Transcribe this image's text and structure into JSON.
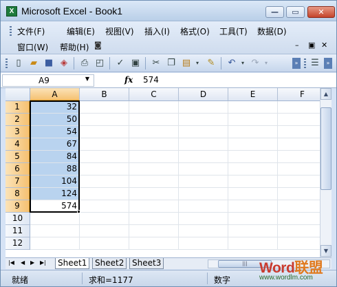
{
  "window": {
    "title": "Microsoft Excel - Book1",
    "app_icon": "excel-x-icon",
    "buttons": {
      "minimize": "—",
      "restore": "▭",
      "close": "✕"
    }
  },
  "menu": {
    "row1": [
      "文件(F)",
      "编辑(E)",
      "视图(V)",
      "插入(I)",
      "格式(O)",
      "工具(T)",
      "数据(D)"
    ],
    "row2": [
      "窗口(W)",
      "帮助(H)"
    ],
    "doc_controls": {
      "minimize": "–",
      "restore": "▣",
      "close": "✕"
    }
  },
  "toolbar": {
    "icons": [
      "new-icon",
      "open-icon",
      "save-icon",
      "permission-icon",
      "print-icon",
      "print-preview-icon",
      "spelling-icon",
      "research-icon",
      "cut-icon",
      "copy-icon",
      "paste-icon",
      "format-painter-icon",
      "undo-icon",
      "redo-icon",
      "align-icon"
    ]
  },
  "formula_bar": {
    "name_box": "A9",
    "fx": "fx",
    "value": "574"
  },
  "sheet": {
    "columns": [
      "A",
      "B",
      "C",
      "D",
      "E",
      "F"
    ],
    "rows": [
      "1",
      "2",
      "3",
      "4",
      "5",
      "6",
      "7",
      "8",
      "9",
      "10",
      "11",
      "12"
    ],
    "col_a_values": [
      "32",
      "50",
      "54",
      "67",
      "84",
      "88",
      "104",
      "124",
      "574"
    ]
  },
  "tabs": {
    "sheets": [
      "Sheet1",
      "Sheet2",
      "Sheet3"
    ],
    "active": "Sheet1"
  },
  "status": {
    "mode": "就绪",
    "sum": "求和=1177",
    "num": "数字"
  },
  "watermark": {
    "logo_en": "Word",
    "logo_cn": "联盟",
    "url": "www.wordlm.com"
  },
  "colors": {
    "selection_fill": "#b9d3ef",
    "header_selected": "#f5c172",
    "watermark_red": "#c93b2f"
  }
}
